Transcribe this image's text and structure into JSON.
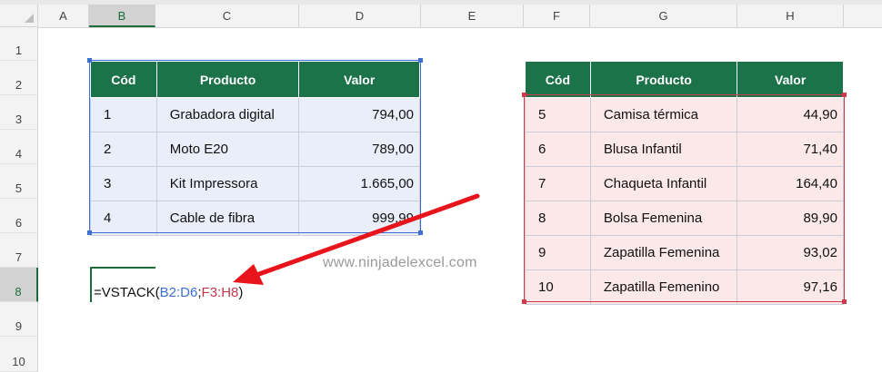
{
  "columns": [
    "A",
    "B",
    "C",
    "D",
    "E",
    "F",
    "G",
    "H"
  ],
  "rows": [
    "1",
    "2",
    "3",
    "4",
    "5",
    "6",
    "7",
    "8",
    "9",
    "10"
  ],
  "selected_column": "B",
  "selected_row": "8",
  "table1": {
    "headers": [
      "Cód",
      "Producto",
      "Valor"
    ],
    "rows": [
      [
        "1",
        "Grabadora digital",
        "794,00"
      ],
      [
        "2",
        "Moto E20",
        "789,00"
      ],
      [
        "3",
        "Kit Impressora",
        "1.665,00"
      ],
      [
        "4",
        "Cable de fibra",
        "999,99"
      ]
    ]
  },
  "table2": {
    "headers": [
      "Cód",
      "Producto",
      "Valor"
    ],
    "rows": [
      [
        "5",
        "Camisa térmica",
        "44,90"
      ],
      [
        "6",
        "Blusa Infantil",
        "71,40"
      ],
      [
        "7",
        "Chaqueta Infantil",
        "164,40"
      ],
      [
        "8",
        "Bolsa Femenina",
        "89,90"
      ],
      [
        "9",
        "Zapatilla Femenina",
        "93,02"
      ],
      [
        "10",
        "Zapatilla Femenino",
        "97,16"
      ]
    ]
  },
  "formula": {
    "prefix": "=VSTACK(",
    "ref1": "B2:D6",
    "sep": ";",
    "ref2": "F3:H8",
    "suffix": ")"
  },
  "watermark": "www.ninjadelexcel.com",
  "colors": {
    "header_green": "#1c7349",
    "ref_blue": "#3c6fd2",
    "ref_red": "#c0394b",
    "arrow_red": "#e8141c"
  },
  "icons": [
    "select-all-triangle-icon",
    "red-arrow-icon"
  ]
}
